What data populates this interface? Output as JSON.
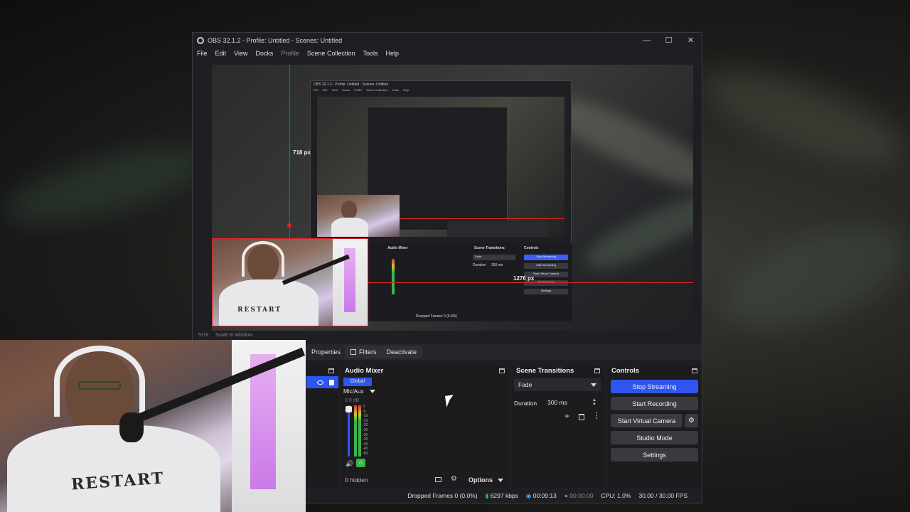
{
  "window": {
    "title": "OBS 32.1.2 - Profile: Untitled - Scenes: Untitled",
    "minimize": "—",
    "maximize": "☐",
    "close": "✕"
  },
  "menu": {
    "items": [
      "File",
      "Edit",
      "View",
      "Docks",
      "Profile",
      "Scene Collection",
      "Tools",
      "Help"
    ]
  },
  "preview": {
    "height_label": "718 px",
    "width_label": "1276 px",
    "zoom": "51%",
    "scale": "Scale to Window"
  },
  "nested": {
    "title": "OBS 32.1.2 - Profile: Untitled - Scenes: Untitled",
    "audio_mixer": "Audio Mixer",
    "scene_transitions": "Scene Transitions",
    "controls": "Controls",
    "fade": "Fade",
    "duration": "Duration",
    "duration_value": "300 ms",
    "stop_streaming": "Stop Streaming",
    "start_recording": "Start Recording",
    "start_virtual_camera": "Start Virtual Camera",
    "studio_mode": "Studio Mode",
    "settings": "Settings",
    "status": "Dropped Frames 0 (0.0%)"
  },
  "toolbar": {
    "properties": "Properties",
    "filters": "Filters",
    "deactivate": "Deactivate"
  },
  "audio_mixer": {
    "title": "Audio Mixer",
    "tab_global": "Global",
    "channel": "Mic/Aux",
    "db": "0.0 dB",
    "ticks": [
      "0",
      "-5",
      "-10",
      "-15",
      "-20",
      "-25",
      "-30",
      "-35",
      "-40",
      "-45",
      "-50"
    ],
    "hidden": "0 hidden",
    "options": "Options"
  },
  "scene_transitions": {
    "title": "Scene Transitions",
    "transition": "Fade",
    "duration_label": "Duration",
    "duration_value": "300 ms"
  },
  "controls": {
    "title": "Controls",
    "stop_streaming": "Stop Streaming",
    "start_recording": "Start Recording",
    "start_virtual_camera": "Start Virtual Camera",
    "studio_mode": "Studio Mode",
    "settings": "Settings"
  },
  "status": {
    "dropped_frames": "Dropped Frames 0 (0.0%)",
    "bitrate": "6297 kbps",
    "stream_time": "00:09:13",
    "record_time": "00:00:00",
    "cpu": "CPU: 1.0%",
    "fps": "30.00 / 30.00 FPS"
  },
  "webcam": {
    "shirt_text": "RESTART"
  },
  "colors": {
    "accent_blue": "#2f55f0",
    "guide_red": "#e0242c",
    "meter_green": "#3ab54a",
    "window_bg": "#1f1f23"
  },
  "icons": {
    "eye": "eye-icon",
    "lock": "lock-icon",
    "gear": "gear-icon",
    "mute": "speaker-icon",
    "headphone": "headphone-icon",
    "add": "plus-icon",
    "trash": "trash-icon",
    "more": "kebab-icon"
  }
}
